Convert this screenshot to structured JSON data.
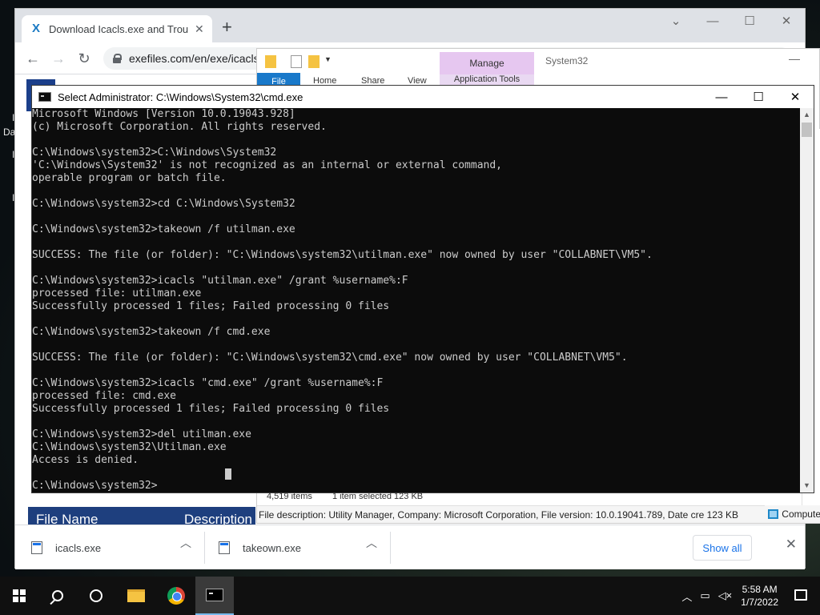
{
  "browser": {
    "tab_title": "Download Icacls.exe and Trouble",
    "tab_icon": "x-logo-icon",
    "url": "exefiles.com/en/exe/icacls",
    "downloads": [
      {
        "name": "icacls.exe"
      },
      {
        "name": "takeown.exe"
      }
    ],
    "show_all_label": "Show all",
    "page_header": {
      "col1": "File Name",
      "col2": "Description"
    }
  },
  "explorer": {
    "manage_label": "Manage",
    "app_tools_label": "Application Tools",
    "window_title": "System32",
    "ribbon_tabs": [
      "File",
      "Home",
      "Share",
      "View"
    ],
    "status_items": "4,519 items",
    "status_selected": "1 item selected  123 KB",
    "status_text": "File description: Utility Manager, Company: Microsoft Corporation, File version: 10.0.19041.789, Date cre 123 KB",
    "computer_label": "Compute"
  },
  "cmd": {
    "title": "Select Administrator: C:\\Windows\\System32\\cmd.exe",
    "lines": [
      "Microsoft Windows [Version 10.0.19043.928]",
      "(c) Microsoft Corporation. All rights reserved.",
      "",
      "C:\\Windows\\system32>C:\\Windows\\System32",
      "'C:\\Windows\\System32' is not recognized as an internal or external command,",
      "operable program or batch file.",
      "",
      "C:\\Windows\\system32>cd C:\\Windows\\System32",
      "",
      "C:\\Windows\\system32>takeown /f utilman.exe",
      "",
      "SUCCESS: The file (or folder): \"C:\\Windows\\system32\\utilman.exe\" now owned by user \"COLLABNET\\VM5\".",
      "",
      "C:\\Windows\\system32>icacls \"utilman.exe\" /grant %username%:F",
      "processed file: utilman.exe",
      "Successfully processed 1 files; Failed processing 0 files",
      "",
      "C:\\Windows\\system32>takeown /f cmd.exe",
      "",
      "SUCCESS: The file (or folder): \"C:\\Windows\\system32\\cmd.exe\" now owned by user \"COLLABNET\\VM5\".",
      "",
      "C:\\Windows\\system32>icacls \"cmd.exe\" /grant %username%:F",
      "processed file: cmd.exe",
      "Successfully processed 1 files; Failed processing 0 files",
      "",
      "C:\\Windows\\system32>del utilman.exe",
      "C:\\Windows\\system32\\Utilman.exe",
      "Access is denied.",
      "",
      "C:\\Windows\\system32>"
    ]
  },
  "taskbar": {
    "time": "5:58 AM",
    "date": "1/7/2022",
    "apps": [
      "start-icon",
      "search-icon",
      "cortana-icon",
      "file-explorer-icon",
      "chrome-icon",
      "cmd-icon"
    ]
  },
  "desktop": {
    "fragments": [
      "I",
      "Da",
      "I",
      "I"
    ]
  },
  "colors": {
    "cmd_bg": "#0c0c0c",
    "cmd_text": "#cccccc",
    "manage_tab": "#e6c7f0",
    "taskbar": "#101010",
    "link_blue": "#1a73e8"
  }
}
